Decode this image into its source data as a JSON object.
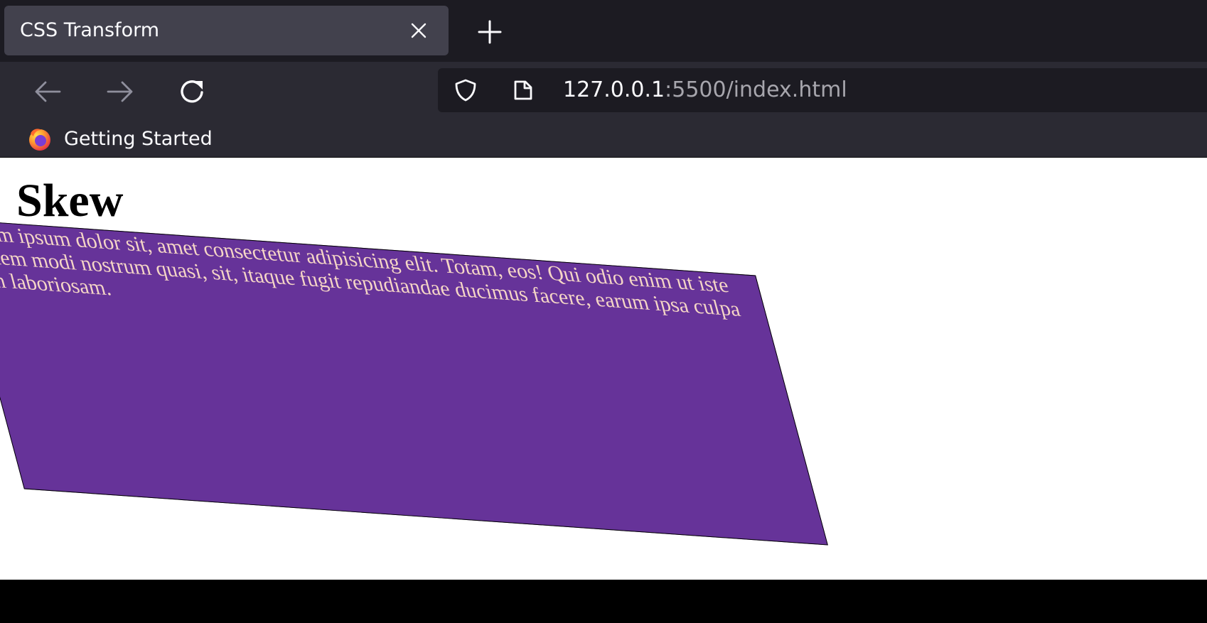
{
  "browser": {
    "tab": {
      "title": "CSS Transform",
      "close_icon": "close-icon"
    },
    "new_tab_icon": "plus-icon",
    "nav": {
      "back_icon": "arrow-left-icon",
      "forward_icon": "arrow-right-icon",
      "reload_icon": "reload-icon"
    },
    "urlbar": {
      "shield_icon": "shield-icon",
      "page_icon": "page-icon",
      "host": "127.0.0.1",
      "rest": ":5500/index.html"
    },
    "bookmarks": [
      {
        "label": "Getting Started",
        "icon": "firefox-icon"
      }
    ]
  },
  "page": {
    "heading": "Skew",
    "paragraph": "Lorem ipsum dolor sit, amet consectetur adipisicing elit. Totam, eos! Qui odio enim ut iste quidem modi nostrum quasi, sit, itaque fugit repudiandae ducimus facere, earum ipsa culpa cum laboriosam.",
    "box_color": "#663399",
    "text_color": "#f5d6c6"
  }
}
